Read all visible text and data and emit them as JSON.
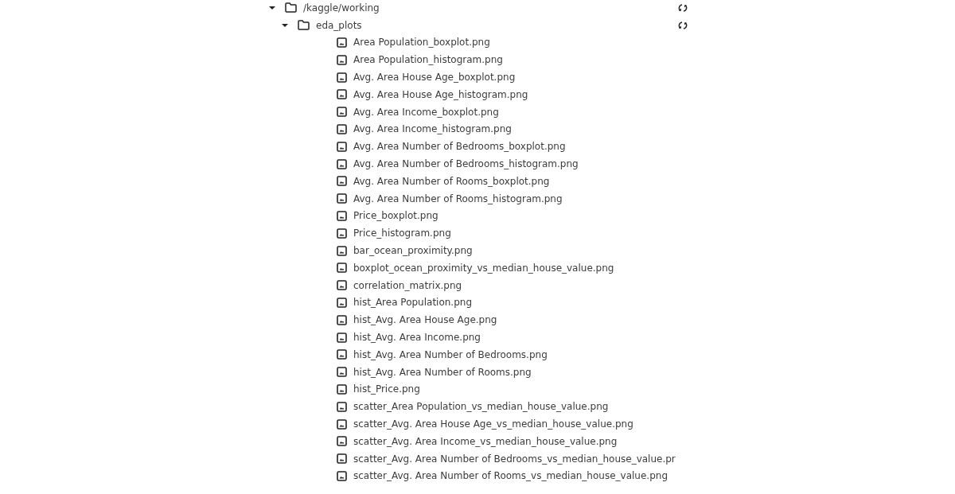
{
  "tree": [
    {
      "kind": "folder",
      "name": "/kaggle/working",
      "expanded": true,
      "children": [
        {
          "kind": "folder",
          "name": "eda_plots",
          "expanded": true,
          "children": [
            {
              "kind": "file",
              "name": "Area Population_boxplot.png"
            },
            {
              "kind": "file",
              "name": "Area Population_histogram.png"
            },
            {
              "kind": "file",
              "name": "Avg. Area House Age_boxplot.png"
            },
            {
              "kind": "file",
              "name": "Avg. Area House Age_histogram.png"
            },
            {
              "kind": "file",
              "name": "Avg. Area Income_boxplot.png"
            },
            {
              "kind": "file",
              "name": "Avg. Area Income_histogram.png"
            },
            {
              "kind": "file",
              "name": "Avg. Area Number of Bedrooms_boxplot.png"
            },
            {
              "kind": "file",
              "name": "Avg. Area Number of Bedrooms_histogram.png"
            },
            {
              "kind": "file",
              "name": "Avg. Area Number of Rooms_boxplot.png"
            },
            {
              "kind": "file",
              "name": "Avg. Area Number of Rooms_histogram.png"
            },
            {
              "kind": "file",
              "name": "Price_boxplot.png"
            },
            {
              "kind": "file",
              "name": "Price_histogram.png"
            },
            {
              "kind": "file",
              "name": "bar_ocean_proximity.png"
            },
            {
              "kind": "file",
              "name": "boxplot_ocean_proximity_vs_median_house_value.png"
            },
            {
              "kind": "file",
              "name": "correlation_matrix.png"
            },
            {
              "kind": "file",
              "name": "hist_Area Population.png"
            },
            {
              "kind": "file",
              "name": "hist_Avg. Area House Age.png"
            },
            {
              "kind": "file",
              "name": "hist_Avg. Area Income.png"
            },
            {
              "kind": "file",
              "name": "hist_Avg. Area Number of Bedrooms.png"
            },
            {
              "kind": "file",
              "name": "hist_Avg. Area Number of Rooms.png"
            },
            {
              "kind": "file",
              "name": "hist_Price.png"
            },
            {
              "kind": "file",
              "name": "scatter_Area Population_vs_median_house_value.png"
            },
            {
              "kind": "file",
              "name": "scatter_Avg. Area House Age_vs_median_house_value.png"
            },
            {
              "kind": "file",
              "name": "scatter_Avg. Area Income_vs_median_house_value.png"
            },
            {
              "kind": "file",
              "name": "scatter_Avg. Area Number of Bedrooms_vs_median_house_value.pr"
            },
            {
              "kind": "file",
              "name": "scatter_Avg. Area Number of Rooms_vs_median_house_value.png"
            }
          ]
        }
      ]
    }
  ]
}
